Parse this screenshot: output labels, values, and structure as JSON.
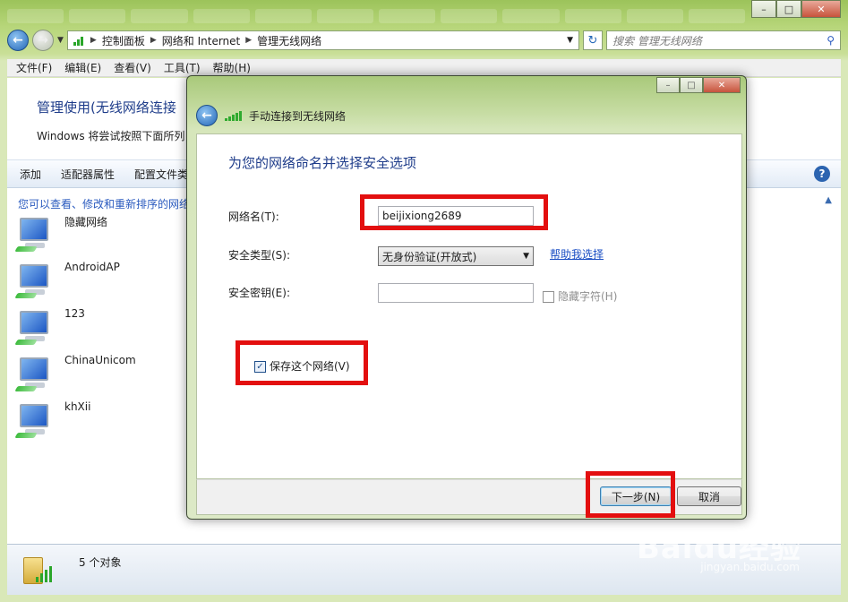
{
  "window": {
    "caption": {
      "minimize": "–",
      "maximize": "□",
      "close": "✕"
    }
  },
  "addressbar": {
    "breadcrumbs": [
      "控制面板",
      "网络和 Internet",
      "管理无线网络"
    ],
    "search_placeholder": "搜索 管理无线网络"
  },
  "menu": [
    "文件(F)",
    "编辑(E)",
    "查看(V)",
    "工具(T)",
    "帮助(H)"
  ],
  "main": {
    "title": "管理使用(无线网络连接",
    "description": "Windows 将尝试按照下面所列",
    "toolbar": [
      "添加",
      "适配器属性",
      "配置文件类"
    ],
    "hint": "您可以查看、修改和重新排序的网络",
    "networks": [
      "隐藏网络",
      "AndroidAP",
      "123",
      "ChinaUnicom",
      "khXii"
    ]
  },
  "status": {
    "count": "5 个对象"
  },
  "watermark": {
    "brand": "Baidu经验",
    "url": "jingyan.baidu.com"
  },
  "dialog": {
    "title": "手动连接到无线网络",
    "heading": "为您的网络命名并选择安全选项",
    "network_name_label": "网络名(T):",
    "network_name_value": "beijixiong2689",
    "security_type_label": "安全类型(S):",
    "security_type_value": "无身份验证(开放式)",
    "help_link": "帮助我选择",
    "security_key_label": "安全密钥(E):",
    "security_key_value": "",
    "hide_chars_label": "隐藏字符(H)",
    "save_network_label": "保存这个网络(V)",
    "save_network_checked": true,
    "next_button": "下一步(N)",
    "cancel_button": "取消"
  },
  "colors": {
    "highlight_border": "#e30f0f",
    "title_blue": "#1e3c8a",
    "link_blue": "#1b4fc4"
  }
}
